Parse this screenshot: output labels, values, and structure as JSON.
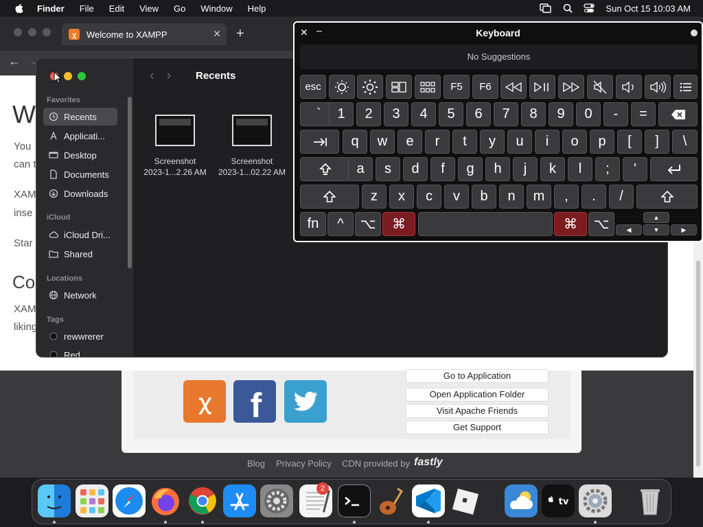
{
  "menubar": {
    "app": "Finder",
    "items": [
      "File",
      "Edit",
      "View",
      "Go",
      "Window",
      "Help"
    ],
    "clock": "Sun Oct 15  10:03 AM"
  },
  "browser": {
    "tab_title": "Welcome to XAMPP",
    "page": {
      "heading": "W",
      "line1": "You",
      "line2": "can t",
      "line3": "XAM",
      "line4": "inse",
      "line5": "Star",
      "heading2": "Co",
      "line6": "XAM",
      "line7": "liking"
    },
    "links": [
      "Go to Application",
      "Open Application Folder",
      "Visit Apache Friends",
      "Get Support"
    ],
    "footer": {
      "blog": "Blog",
      "privacy": "Privacy Policy",
      "cdn": "CDN provided by",
      "brand": "fastly"
    }
  },
  "finder": {
    "title": "Recents",
    "sections": {
      "favorites": "Favorites",
      "icloud": "iCloud",
      "locations": "Locations",
      "tags": "Tags"
    },
    "favorites": [
      "Recents",
      "Applicati...",
      "Desktop",
      "Documents",
      "Downloads"
    ],
    "icloud_items": [
      "iCloud Dri...",
      "Shared"
    ],
    "locations": [
      "Network"
    ],
    "tags": [
      "rewwrerer",
      "Red"
    ],
    "files": [
      {
        "name": "Screenshot",
        "date": "2023-1...2.26 AM"
      },
      {
        "name": "Screenshot",
        "date": "2023-1...02.22 AM"
      }
    ]
  },
  "keyboard": {
    "title": "Keyboard",
    "suggestions": "No Suggestions",
    "row0": [
      "esc",
      "F5",
      "F6"
    ],
    "row1": [
      "`",
      "1",
      "2",
      "3",
      "4",
      "5",
      "6",
      "7",
      "8",
      "9",
      "0",
      "-",
      "="
    ],
    "row2": [
      "q",
      "w",
      "e",
      "r",
      "t",
      "y",
      "u",
      "i",
      "o",
      "p",
      "[",
      "]",
      "\\"
    ],
    "row3": [
      "a",
      "s",
      "d",
      "f",
      "g",
      "h",
      "j",
      "k",
      "l",
      ";",
      "'"
    ],
    "row4": [
      "z",
      "x",
      "c",
      "v",
      "b",
      "n",
      "m",
      ",",
      ".",
      "/"
    ],
    "row5": [
      "fn",
      "^",
      "⌥",
      "⌘",
      "⌘",
      "⌥"
    ]
  },
  "dock": {
    "badge_count": "2"
  }
}
